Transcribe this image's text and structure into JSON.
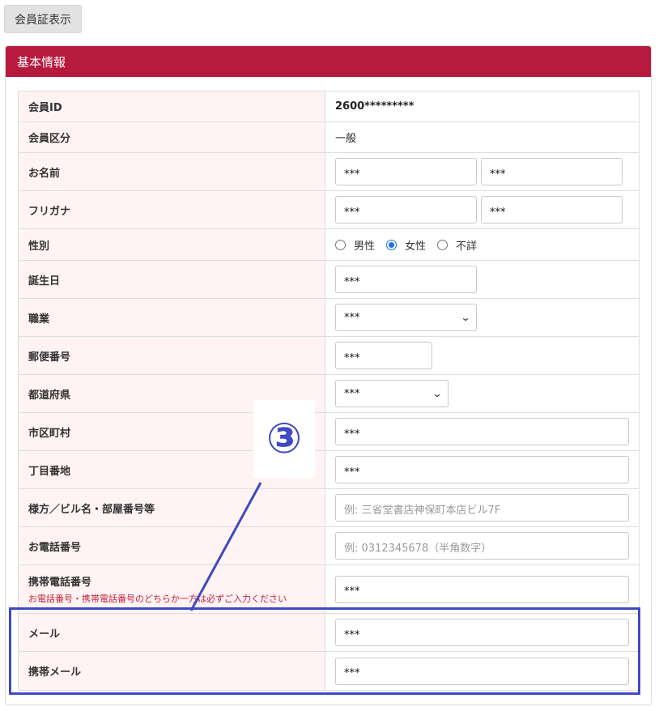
{
  "top_button_label": "会員証表示",
  "panel_title": "基本情報",
  "colors": {
    "header": "#b8193e",
    "label_bg": "#fff3f3",
    "annotation": "#3f49c6",
    "note": "#c2223d"
  },
  "fields": {
    "member_id": {
      "label": "会員ID",
      "value": "2600*********"
    },
    "member_type": {
      "label": "会員区分",
      "value": "一般"
    },
    "name": {
      "label": "お名前",
      "last": "***",
      "first": "***"
    },
    "furigana": {
      "label": "フリガナ",
      "last": "***",
      "first": "***"
    },
    "gender": {
      "label": "性別",
      "options": [
        "男性",
        "女性",
        "不詳"
      ],
      "selected": "女性"
    },
    "birthday": {
      "label": "誕生日",
      "value": "***"
    },
    "occupation": {
      "label": "職業",
      "value": "***"
    },
    "postal_code": {
      "label": "郵便番号",
      "value": "***"
    },
    "prefecture": {
      "label": "都道府県",
      "value": "***"
    },
    "city": {
      "label": "市区町村",
      "value": "***"
    },
    "address": {
      "label": "丁目番地",
      "value": "***"
    },
    "building": {
      "label": "様方／ビル名・部屋番号等",
      "placeholder": "例: 三省堂書店神保町本店ビル7F"
    },
    "phone": {
      "label": "お電話番号",
      "placeholder": "例: 0312345678（半角数字）"
    },
    "mobile": {
      "label": "携帯電話番号",
      "note": "お電話番号・携帯電話番号のどちらか一方は必ずご入力ください",
      "value": "***"
    },
    "email": {
      "label": "メール",
      "value": "***"
    },
    "mobile_email": {
      "label": "携帯メール",
      "value": "***"
    }
  },
  "annotation": {
    "number": "③"
  }
}
